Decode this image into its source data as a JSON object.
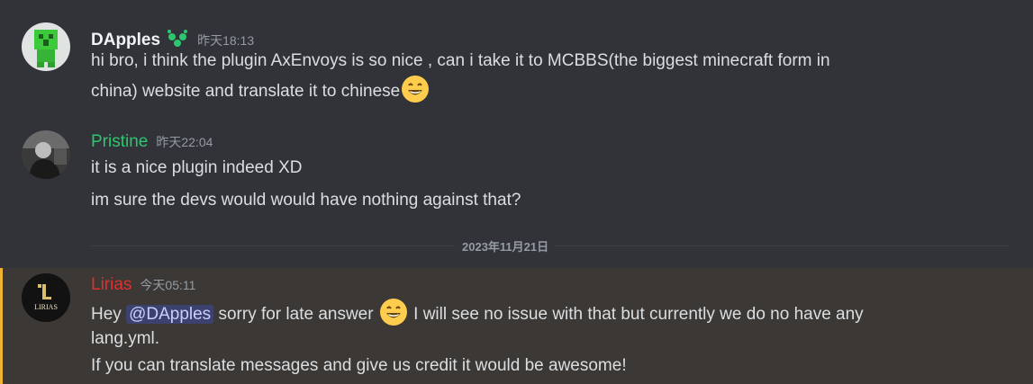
{
  "messages": [
    {
      "username": "DApples",
      "username_color": "#f2f3f5",
      "badge_icon": "leaf-badge-icon",
      "timestamp": "昨天18:13",
      "lines": [
        "hi bro, i think the plugin AxEnvoys is so nice , can i  take it to MCBBS(the biggest minecraft form in",
        "china) website and translate it to chinese"
      ],
      "emoji": "grinning-face-emoji"
    },
    {
      "username": "Pristine",
      "username_color": "#2dc770",
      "timestamp": "昨天22:04",
      "lines": [
        "it is a nice plugin indeed XD",
        "im sure the devs would would have nothing against that?"
      ]
    },
    {
      "username": "Lirias",
      "username_color": "#e03131",
      "timestamp": "今天05:11",
      "avatar_text": "LIRIAS",
      "line1_prefix": "Hey ",
      "mention": "@DApples",
      "line1_mid": " sorry for late answer ",
      "line1_suffix": " I will see no issue with that but currently we do no have any",
      "line2": "lang.yml.",
      "line3": "If you can translate messages and give us credit it would be awesome!",
      "emoji": "grinning-face-emoji",
      "highlight_color": "#f0b232"
    }
  ],
  "date_divider": "2023年11月21日"
}
